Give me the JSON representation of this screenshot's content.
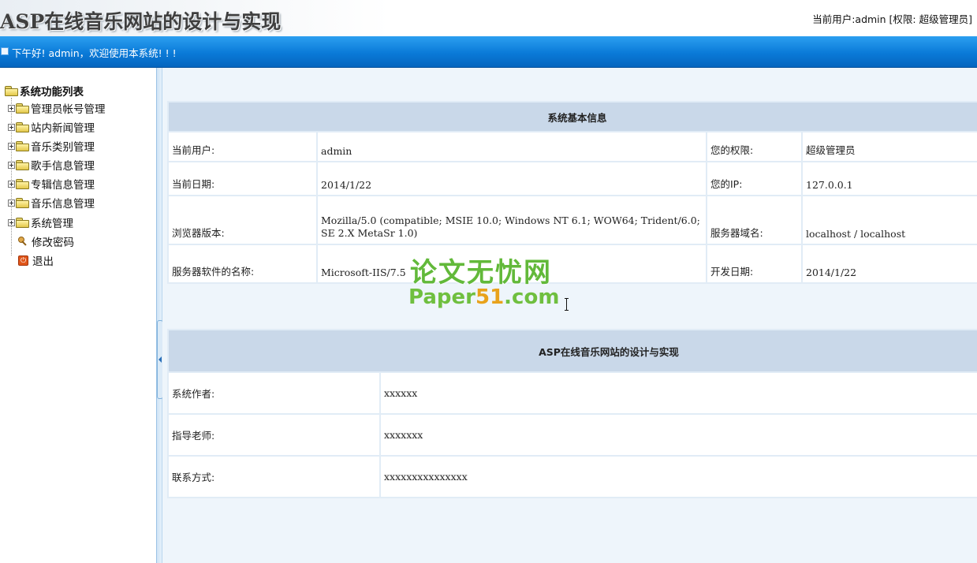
{
  "header": {
    "title": "ASP在线音乐网站的设计与实现",
    "user_info": "当前用户:admin [权限: 超级管理员]"
  },
  "topbar": {
    "greeting": "下午好! admin，欢迎使用本系统! ! !"
  },
  "sidebar": {
    "root_label": "系统功能列表",
    "items": [
      {
        "label": "管理员帐号管理",
        "icon": "folder-icon"
      },
      {
        "label": "站内新闻管理",
        "icon": "folder-icon"
      },
      {
        "label": "音乐类别管理",
        "icon": "folder-icon"
      },
      {
        "label": "歌手信息管理",
        "icon": "folder-icon"
      },
      {
        "label": "专辑信息管理",
        "icon": "folder-icon"
      },
      {
        "label": "音乐信息管理",
        "icon": "folder-icon"
      },
      {
        "label": "系统管理",
        "icon": "folder-icon"
      }
    ],
    "leaves": [
      {
        "label": "修改密码",
        "icon": "key-icon"
      },
      {
        "label": "退出",
        "icon": "exit-icon"
      }
    ]
  },
  "system_info": {
    "heading": "系统基本信息",
    "rows": [
      {
        "label1": "当前用户:",
        "value1": "admin",
        "label2": "您的权限:",
        "value2": "超级管理员"
      },
      {
        "label1": "当前日期:",
        "value1": "2014/1/22",
        "label2": "您的IP:",
        "value2": "127.0.0.1"
      },
      {
        "label1": "浏览器版本:",
        "value1": "Mozilla/5.0 (compatible; MSIE 10.0; Windows NT 6.1; WOW64; Trident/6.0; SE 2.X MetaSr 1.0)",
        "label2": "服务器域名:",
        "value2": "localhost / localhost"
      },
      {
        "label1": "服务器软件的名称:",
        "value1": "Microsoft-IIS/7.5",
        "label2": "开发日期:",
        "value2": "2014/1/22"
      }
    ]
  },
  "project_info": {
    "heading": "ASP在线音乐网站的设计与实现",
    "rows": [
      {
        "label": "系统作者:",
        "value": "xxxxxx"
      },
      {
        "label": "指导老师:",
        "value": "xxxxxxx"
      },
      {
        "label": "联系方式:",
        "value": "xxxxxxxxxxxxxxx"
      }
    ]
  },
  "watermark": {
    "cn": "论文无忧网",
    "en_a": "Paper",
    "en_b": "51",
    "en_c": ".com"
  }
}
